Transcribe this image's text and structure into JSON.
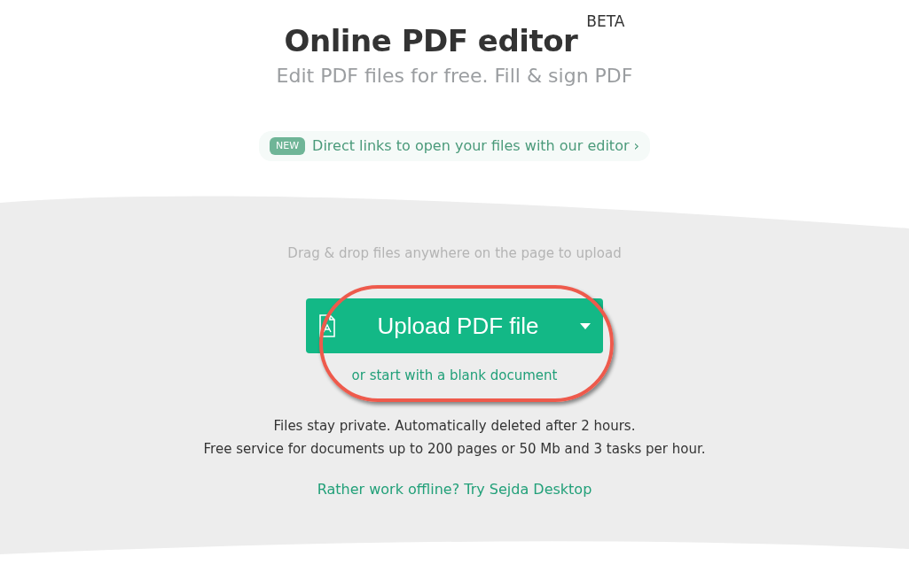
{
  "header": {
    "title": "Online PDF editor",
    "badge": "BETA",
    "subtitle": "Edit PDF files for free. Fill & sign PDF"
  },
  "announcement": {
    "tag": "NEW",
    "text": "Direct links to open your files with our editor",
    "arrow": "›"
  },
  "upload": {
    "hint": "Drag & drop files anywhere on the page to upload",
    "button": "Upload PDF file",
    "blank_link": "or start with a blank document",
    "highlighted": true
  },
  "notes": [
    "Files stay private. Automatically deleted after 2 hours.",
    "Free service for documents up to 200 pages or 50 Mb and 3 tasks per hour."
  ],
  "desktop_link": "Rather work offline? Try Sejda Desktop"
}
